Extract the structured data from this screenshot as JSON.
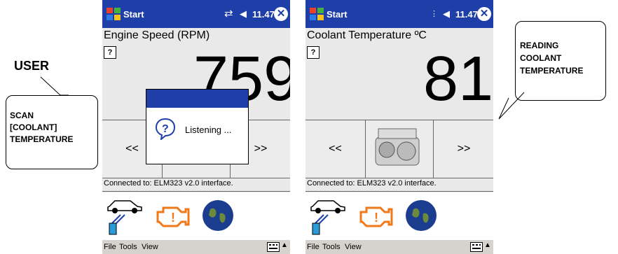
{
  "user_label": "USER",
  "callout_left": {
    "line1": "SCAN",
    "line2": "[COOLANT]",
    "line3": "TEMPERATURE"
  },
  "callout_right": {
    "line1": "READING",
    "line2": "COOLANT",
    "line3": "TEMPERATURE"
  },
  "colors": {
    "titlebar": "#1f3fa8",
    "engine_warning": "#f07a1a",
    "menubar": "#d6d3ce"
  },
  "screens": [
    {
      "titlebar": {
        "start_label": "Start",
        "time": "11.47",
        "sync_icon": "sync-arrows-icon"
      },
      "parameter_label": "Engine Speed (RPM)",
      "help_label": "?",
      "reading": "759",
      "nav": {
        "prev_label": "<<",
        "next_label": ">>"
      },
      "status": "Connected to: ELM323 v2.0 interface.",
      "menu": {
        "file": "File",
        "tools": "Tools",
        "view": "View"
      }
    },
    {
      "titlebar": {
        "start_label": "Start",
        "time": "11.47",
        "sync_icon": ""
      },
      "parameter_label": "Coolant Temperature ºC",
      "help_label": "?",
      "reading": "81",
      "nav": {
        "prev_label": "<<",
        "next_label": ">>"
      },
      "status": "Connected to: ELM323 v2.0 interface.",
      "menu": {
        "file": "File",
        "tools": "Tools",
        "view": "View"
      }
    }
  ],
  "dialog": {
    "text": "Listening ...",
    "icon": "question-speech-icon"
  }
}
